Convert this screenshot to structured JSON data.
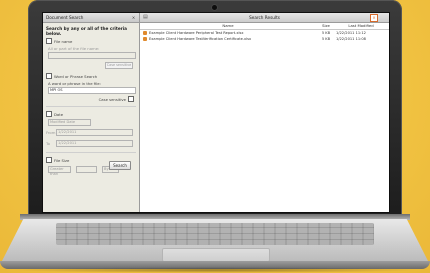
{
  "left_pane": {
    "title": "Document Search",
    "close": "×",
    "heading": "Search by any or all of the criteria below.",
    "file_name_label": "File name",
    "file_name_sub": "All or part of the file name:",
    "case_sensitive": "Case sensitive",
    "phrase_label": "Word or Phrase Search",
    "phrase_sub": "A word or phrase in the file:",
    "phrase_value": "MPI OS",
    "case_sensitive_2": "Case sensitive",
    "date_label": "Date",
    "date_field": "Modified Date",
    "from_label": "From",
    "from_value": "1/22/2011",
    "to_label": "To",
    "to_value": "1/22/2011",
    "size_label": "File Size",
    "size_option": "Greater than",
    "size_unit": "Bytes",
    "search_button": "Search"
  },
  "right_pane": {
    "title": "Search Results",
    "icon": "search-results-icon",
    "close": "×",
    "columns": [
      "Name",
      "Size",
      "Last Modified"
    ],
    "rows": [
      {
        "name": "Example Client Hardware Peripheral Test Report.xlsx",
        "size": "5 KB",
        "modified": "1/22/2011 11:12"
      },
      {
        "name": "Example Client Hardware TestVerification Certificate.xlsx",
        "size": "5 KB",
        "modified": "1/22/2011 11:08"
      }
    ]
  },
  "colors": {
    "background": "#f2c443",
    "accent": "#e08a2e"
  }
}
